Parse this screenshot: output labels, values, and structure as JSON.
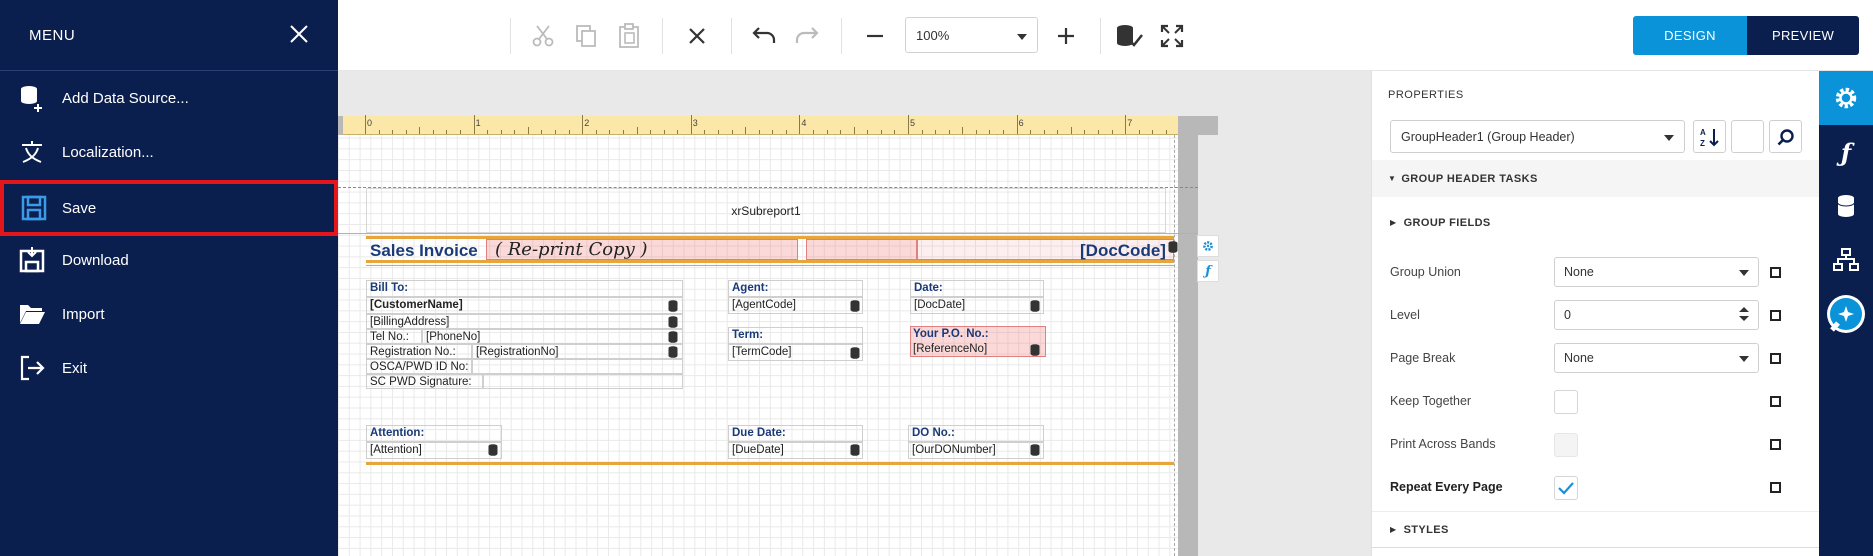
{
  "colors": {
    "menu_bg": "#0b1f4e",
    "accent": "#0a93d8",
    "selected_outline": "#e3161b",
    "ruler": "#fbe7a8"
  },
  "menu": {
    "title": "MENU",
    "items": [
      {
        "label": "Add Data Source...",
        "icon": "add-datasource-icon"
      },
      {
        "label": "Localization...",
        "icon": "localization-icon"
      },
      {
        "label": "Save",
        "icon": "save-icon",
        "selected": true
      },
      {
        "label": "Download",
        "icon": "download-icon"
      },
      {
        "label": "Import",
        "icon": "import-folder-icon"
      },
      {
        "label": "Exit",
        "icon": "exit-icon"
      }
    ]
  },
  "toolbar": {
    "zoom_value": "100%",
    "design_label": "DESIGN",
    "preview_label": "PREVIEW",
    "active_mode": "DESIGN"
  },
  "ruler": {
    "labels": [
      "0",
      "1",
      "2",
      "3",
      "4",
      "5",
      "6",
      "7"
    ]
  },
  "report": {
    "subreport": "xrSubreport1",
    "title": "Sales Invoice",
    "reprint": "( Re-print Copy )",
    "doccode": "[DocCode]",
    "bill_to": "Bill To:",
    "customer_name": "[CustomerName]",
    "billing_address": "[BillingAddress]",
    "tel_label": "Tel No.:",
    "phone": "[PhoneNo]",
    "reg_label": "Registration No.:",
    "reg_value": "[RegistrationNo]",
    "osca_label": "OSCA/PWD ID No:",
    "sc_label": "SC PWD Signature:",
    "agent_label": "Agent:",
    "agent_code": "[AgentCode]",
    "date_label": "Date:",
    "doc_date": "[DocDate]",
    "term_label": "Term:",
    "term_code": "[TermCode]",
    "po_label": "Your P.O. No.:",
    "reference": "[ReferenceNo]",
    "attention_label": "Attention:",
    "attention": "[Attention]",
    "due_label": "Due Date:",
    "due_date": "[DueDate]",
    "do_label": "DO No.:",
    "do_number": "[OurDONumber]"
  },
  "properties": {
    "title": "PROPERTIES",
    "selected_component": "GroupHeader1 (Group Header)",
    "tasks_header": "GROUP HEADER TASKS",
    "group_fields": "GROUP FIELDS",
    "rows": [
      {
        "label": "Group Union",
        "type": "select",
        "value": "None"
      },
      {
        "label": "Level",
        "type": "spin",
        "value": "0"
      },
      {
        "label": "Page Break",
        "type": "select",
        "value": "None"
      },
      {
        "label": "Keep Together",
        "type": "check",
        "value": ""
      },
      {
        "label": "Print Across Bands",
        "type": "check-disabled",
        "value": ""
      },
      {
        "label": "Repeat Every Page",
        "type": "check-on",
        "value": "",
        "bold": true
      }
    ],
    "styles_header": "STYLES"
  }
}
